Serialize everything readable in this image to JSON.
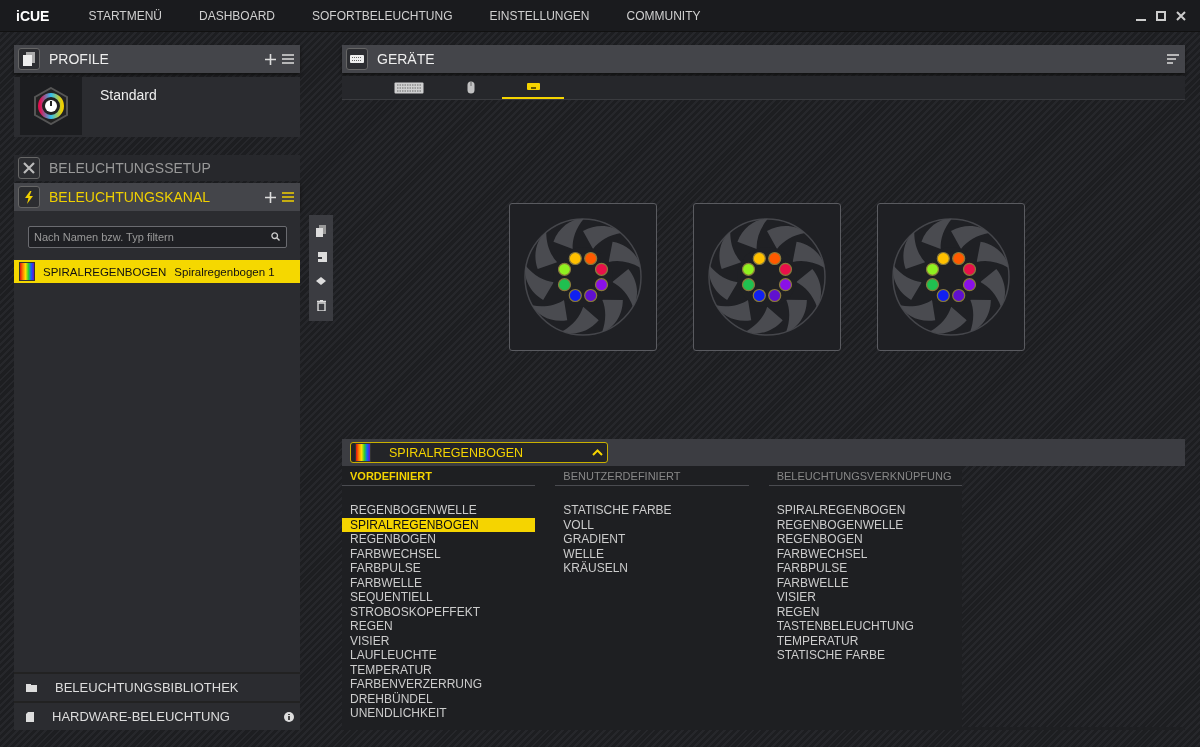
{
  "app": {
    "logo": "iCUE",
    "nav": [
      {
        "label": "STARTMENÜ"
      },
      {
        "label": "DASHBOARD"
      },
      {
        "label": "SOFORTBELEUCHTUNG"
      },
      {
        "label": "EINSTELLUNGEN"
      },
      {
        "label": "COMMUNITY"
      }
    ]
  },
  "profiles": {
    "title": "PROFILE",
    "items": [
      {
        "name": "Standard"
      }
    ]
  },
  "lighting_setup": {
    "title": "BELEUCHTUNGSSETUP"
  },
  "lighting_channel": {
    "title": "BELEUCHTUNGSKANAL",
    "search": {
      "placeholder": "Nach Namen bzw. Typ filtern"
    },
    "layers": [
      {
        "effect": "SPIRALREGENBOGEN",
        "name": "Spiralregenbogen 1",
        "selected": true
      }
    ]
  },
  "library": {
    "title": "BELEUCHTUNGSBIBLIOTHEK"
  },
  "hardware_lighting": {
    "title": "HARDWARE-BELEUCHTUNG"
  },
  "devices": {
    "title": "GERÄTE",
    "tabs": [
      {
        "kind": "keyboard",
        "selected": false
      },
      {
        "kind": "mouse",
        "selected": false
      },
      {
        "kind": "controller",
        "selected": true
      }
    ]
  },
  "fans": [
    {
      "leds": [
        {
          "color": "#ffc000"
        },
        {
          "color": "#ff5a00"
        },
        {
          "color": "#e8104a"
        },
        {
          "color": "#8a10e8"
        },
        {
          "color": "#6010d0"
        },
        {
          "color": "#1020f0"
        },
        {
          "color": "#20c050"
        },
        {
          "color": "#90f020"
        }
      ]
    },
    {
      "leds": [
        {
          "color": "#ffc000"
        },
        {
          "color": "#ff5a00"
        },
        {
          "color": "#e8104a"
        },
        {
          "color": "#8a10e8"
        },
        {
          "color": "#6010d0"
        },
        {
          "color": "#1020f0"
        },
        {
          "color": "#20c050"
        },
        {
          "color": "#90f020"
        }
      ]
    },
    {
      "leds": [
        {
          "color": "#ffc000"
        },
        {
          "color": "#ff5a00"
        },
        {
          "color": "#e8104a"
        },
        {
          "color": "#8a10e8"
        },
        {
          "color": "#6010d0"
        },
        {
          "color": "#1020f0"
        },
        {
          "color": "#20c050"
        },
        {
          "color": "#90f020"
        }
      ]
    }
  ],
  "effect_picker": {
    "value": "SPIRALREGENBOGEN",
    "expanded": true,
    "columns": [
      {
        "title": "VORDEFINIERT",
        "selected": true,
        "items": [
          {
            "label": "REGENBOGENWELLE",
            "selected": false
          },
          {
            "label": "SPIRALREGENBOGEN",
            "selected": true
          },
          {
            "label": "REGENBOGEN",
            "selected": false
          },
          {
            "label": "FARBWECHSEL",
            "selected": false
          },
          {
            "label": "FARBPULSE",
            "selected": false
          },
          {
            "label": "FARBWELLE",
            "selected": false
          },
          {
            "label": "SEQUENTIELL",
            "selected": false
          },
          {
            "label": "STROBOSKOPEFFEKT",
            "selected": false
          },
          {
            "label": "REGEN",
            "selected": false
          },
          {
            "label": "VISIER",
            "selected": false
          },
          {
            "label": "LAUFLEUCHTE",
            "selected": false
          },
          {
            "label": "TEMPERATUR",
            "selected": false
          },
          {
            "label": "FARBENVERZERRUNG",
            "selected": false
          },
          {
            "label": "DREHBÜNDEL",
            "selected": false
          },
          {
            "label": "UNENDLICHKEIT",
            "selected": false
          }
        ]
      },
      {
        "title": "BENUTZERDEFINIERT",
        "selected": false,
        "items": [
          {
            "label": "STATISCHE FARBE",
            "selected": false
          },
          {
            "label": "VOLL",
            "selected": false
          },
          {
            "label": "GRADIENT",
            "selected": false
          },
          {
            "label": "WELLE",
            "selected": false
          },
          {
            "label": "KRÄUSELN",
            "selected": false
          }
        ]
      },
      {
        "title": "BELEUCHTUNGSVERKNÜPFUNG",
        "selected": false,
        "items": [
          {
            "label": "SPIRALREGENBOGEN",
            "selected": false
          },
          {
            "label": "REGENBOGENWELLE",
            "selected": false
          },
          {
            "label": "REGENBOGEN",
            "selected": false
          },
          {
            "label": "FARBWECHSEL",
            "selected": false
          },
          {
            "label": "FARBPULSE",
            "selected": false
          },
          {
            "label": "FARBWELLE",
            "selected": false
          },
          {
            "label": "VISIER",
            "selected": false
          },
          {
            "label": "REGEN",
            "selected": false
          },
          {
            "label": "TASTENBELEUCHTUNG",
            "selected": false
          },
          {
            "label": "TEMPERATUR",
            "selected": false
          },
          {
            "label": "STATISCHE FARBE",
            "selected": false
          }
        ]
      }
    ]
  }
}
